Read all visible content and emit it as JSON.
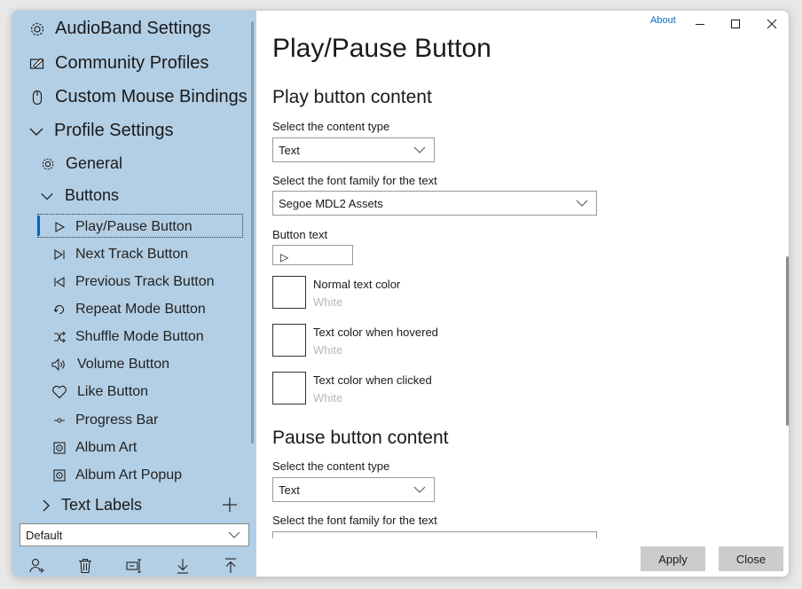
{
  "sidebar": {
    "items": [
      {
        "label": "AudioBand Settings",
        "icon": "gear-icon"
      },
      {
        "label": "Community Profiles",
        "icon": "edit-board-icon"
      },
      {
        "label": "Custom Mouse Bindings",
        "icon": "mouse-icon"
      },
      {
        "label": "Profile Settings",
        "icon": "chevron-down-icon"
      },
      {
        "label": "General",
        "icon": "gear-icon"
      },
      {
        "label": "Buttons",
        "icon": "chevron-down-icon"
      },
      {
        "label": "Play/Pause Button",
        "icon": "play-icon"
      },
      {
        "label": "Next Track Button",
        "icon": "next-track-icon"
      },
      {
        "label": "Previous Track Button",
        "icon": "previous-track-icon"
      },
      {
        "label": "Repeat Mode Button",
        "icon": "repeat-icon"
      },
      {
        "label": "Shuffle Mode Button",
        "icon": "shuffle-icon"
      },
      {
        "label": "Volume Button",
        "icon": "volume-icon"
      },
      {
        "label": "Like Button",
        "icon": "heart-icon"
      },
      {
        "label": "Progress Bar",
        "icon": "progress-icon"
      },
      {
        "label": "Album Art",
        "icon": "album-art-icon"
      },
      {
        "label": "Album Art Popup",
        "icon": "album-art-icon"
      },
      {
        "label": "Text Labels",
        "icon": "chevron-right-icon"
      }
    ],
    "selected": "Play/Pause Button",
    "profile_select": {
      "value": "Default"
    },
    "bottom_buttons": [
      "add-user-icon",
      "delete-icon",
      "rename-icon",
      "import-icon",
      "export-icon"
    ]
  },
  "titlebar": {
    "about": "About"
  },
  "main": {
    "title": "Play/Pause Button",
    "play_section": {
      "title": "Play button content",
      "content_type_label": "Select the content type",
      "content_type_value": "Text",
      "font_label": "Select the font family for the text",
      "font_value": "Segoe MDL2 Assets",
      "button_text_label": "Button text",
      "button_text_value": "▷",
      "colors": [
        {
          "title": "Normal text color",
          "value": "White"
        },
        {
          "title": "Text color when hovered",
          "value": "White"
        },
        {
          "title": "Text color when clicked",
          "value": "White"
        }
      ]
    },
    "pause_section": {
      "title": "Pause button content",
      "content_type_label": "Select the content type",
      "content_type_value": "Text",
      "font_label": "Select the font family for the text"
    }
  },
  "footer": {
    "apply": "Apply",
    "close": "Close"
  },
  "colors": {
    "sidebar_bg": "#b3cfe5",
    "accent": "#0a5fb4",
    "link": "#0a6cc4"
  }
}
